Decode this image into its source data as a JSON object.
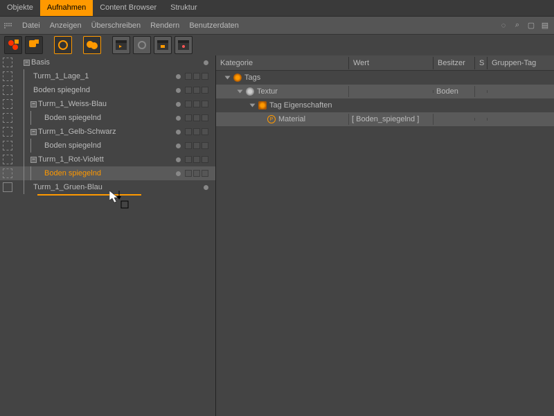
{
  "tabs": {
    "objekte": "Objekte",
    "aufnahmen": "Aufnahmen",
    "content_browser": "Content Browser",
    "struktur": "Struktur"
  },
  "menu": {
    "datei": "Datei",
    "anzeigen": "Anzeigen",
    "ueberschreiben": "Überschreiben",
    "rendern": "Rendern",
    "benutzerdaten": "Benutzerdaten"
  },
  "tree": {
    "basis": "Basis",
    "turm1lage1": "Turm_1_Lage_1",
    "boden1": "Boden spiegelnd",
    "turm1weissblau": "Turm_1_Weiss-Blau",
    "boden2": "Boden spiegelnd",
    "turm1gelbschwarz": "Turm_1_Gelb-Schwarz",
    "boden3": "Boden spiegelnd",
    "turm1rotviolett": "Turm_1_Rot-Violett",
    "boden4": "Boden spiegelnd",
    "turm1gruenblau": "Turm_1_Gruen-Blau"
  },
  "propHeader": {
    "kat": "Kategorie",
    "wert": "Wert",
    "besitzer": "Besitzer",
    "s": "S",
    "grp": "Gruppen-Tag"
  },
  "prop": {
    "tags": "Tags",
    "textur": "Textur",
    "textur_owner": "Boden",
    "tagEig": "Tag Eigenschaften",
    "material": "Material",
    "material_val": "[ Boden_spiegelnd ]"
  }
}
